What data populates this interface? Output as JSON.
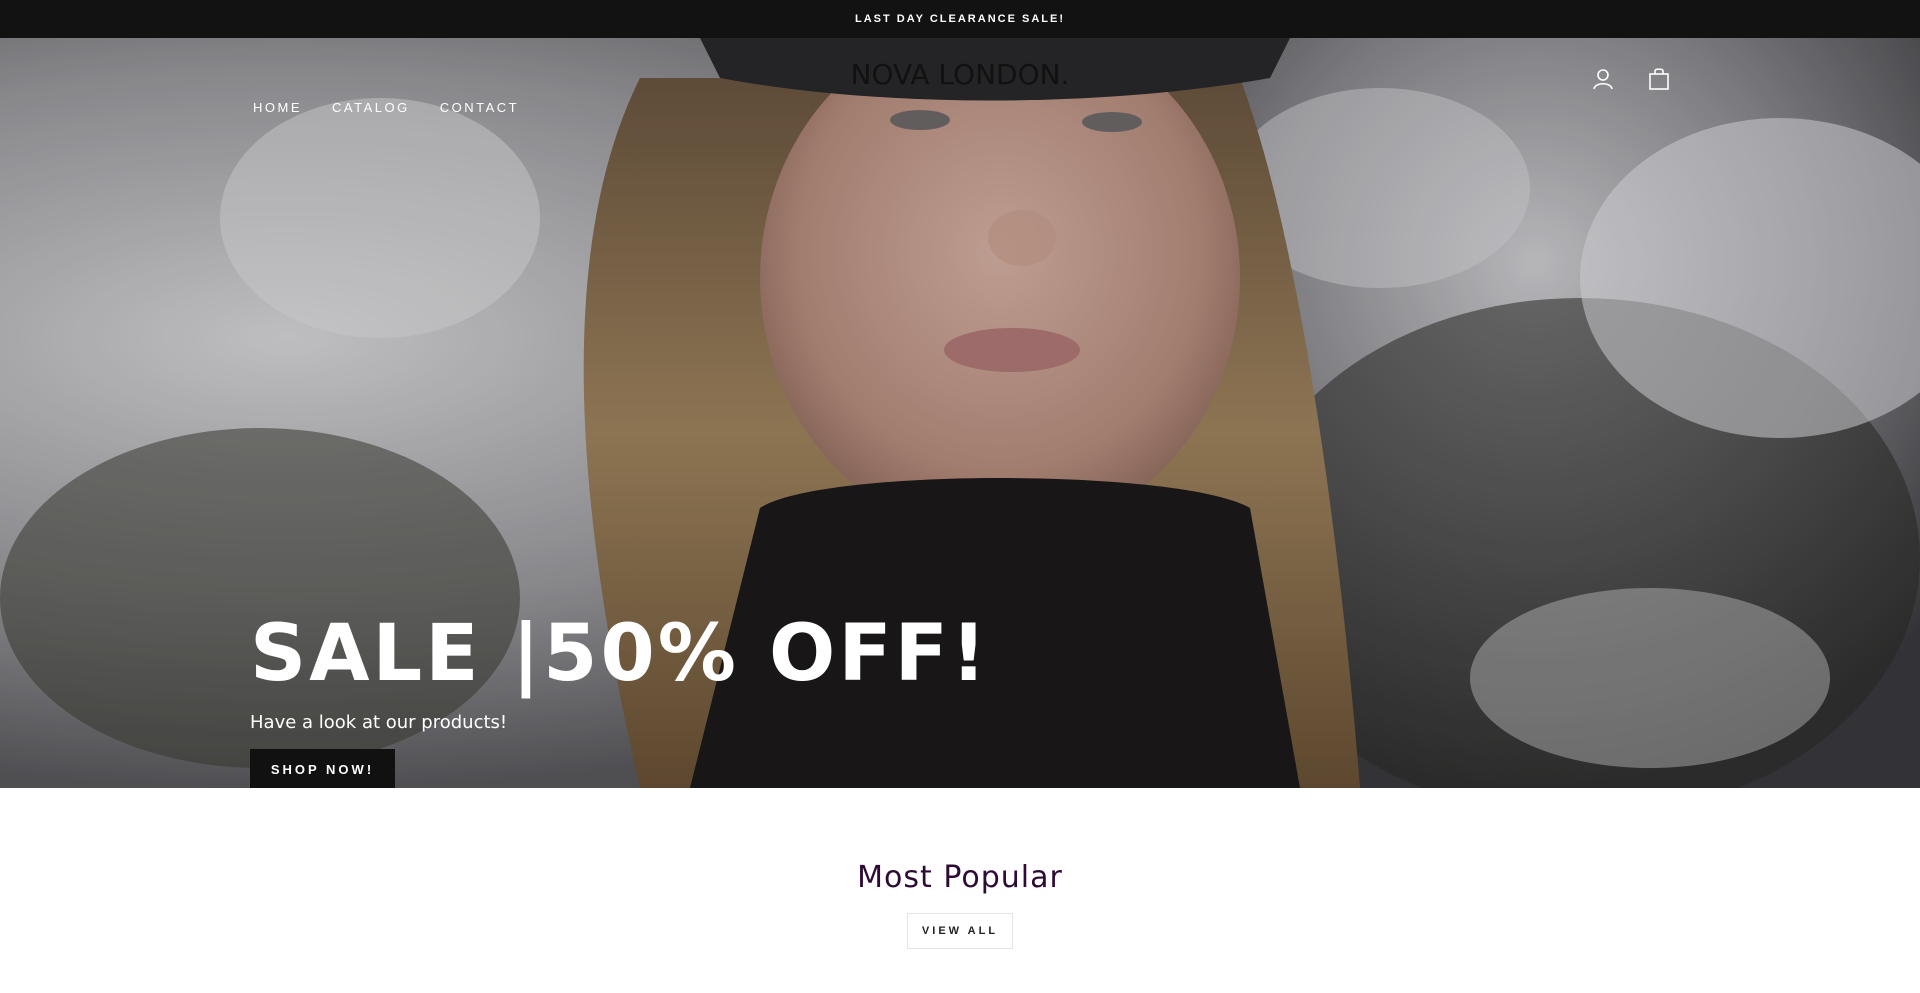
{
  "announcement": {
    "text": "LAST DAY CLEARANCE SALE!"
  },
  "header": {
    "nav": [
      {
        "label": "HOME"
      },
      {
        "label": "CATALOG"
      },
      {
        "label": "CONTACT"
      }
    ],
    "logo": "NOVA LONDON.",
    "icons": [
      "account-icon",
      "cart-icon"
    ]
  },
  "hero": {
    "title": "SALE |50% OFF!",
    "subtitle": "Have a look at our products!",
    "cta_label": "SHOP NOW!"
  },
  "popular": {
    "title": "Most Popular",
    "view_all_label": "VIEW ALL"
  },
  "colors": {
    "announcement_bg": "#121212",
    "button_bg": "#111111",
    "section_title": "#2d0b34"
  }
}
